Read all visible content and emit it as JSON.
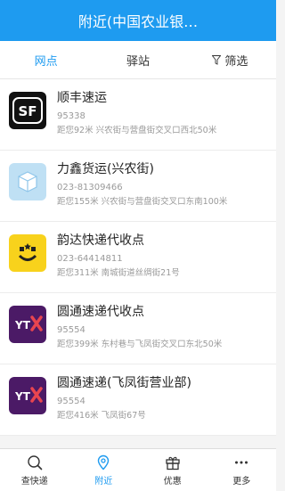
{
  "header": {
    "title": "附近(中国农业银…"
  },
  "tabs": [
    {
      "label": "网点"
    },
    {
      "label": "驿站"
    },
    {
      "label": "筛选"
    }
  ],
  "stations": [
    {
      "name": "顺丰速运",
      "phone": "95338",
      "address": "距您92米 兴农街与营盘街交叉口西北50米",
      "logo_color": "#111111"
    },
    {
      "name": "力鑫货运(兴农街)",
      "phone": "023-81309466",
      "address": "距您155米 兴农街与营盘街交叉口东南100米",
      "logo_color": "#bfe0f4"
    },
    {
      "name": "韵达快递代收点",
      "phone": "023-64414811",
      "address": "距您311米 南城街道丝绸街21号",
      "logo_color": "#f8d21c"
    },
    {
      "name": "圆通速递代收点",
      "phone": "95554",
      "address": "距您399米 东村巷与飞凤街交叉口东北50米",
      "logo_color": "#4b1a66"
    },
    {
      "name": "圆通速递(飞凤街营业部)",
      "phone": "95554",
      "address": "距您416米 飞凤街67号",
      "logo_color": "#4b1a66"
    }
  ],
  "bottom_nav": [
    {
      "label": "查快递",
      "icon": "search-icon"
    },
    {
      "label": "附近",
      "icon": "location-icon"
    },
    {
      "label": "优惠",
      "icon": "gift-icon"
    },
    {
      "label": "更多",
      "icon": "more-icon"
    }
  ],
  "colors": {
    "accent": "#1e9bf0"
  }
}
